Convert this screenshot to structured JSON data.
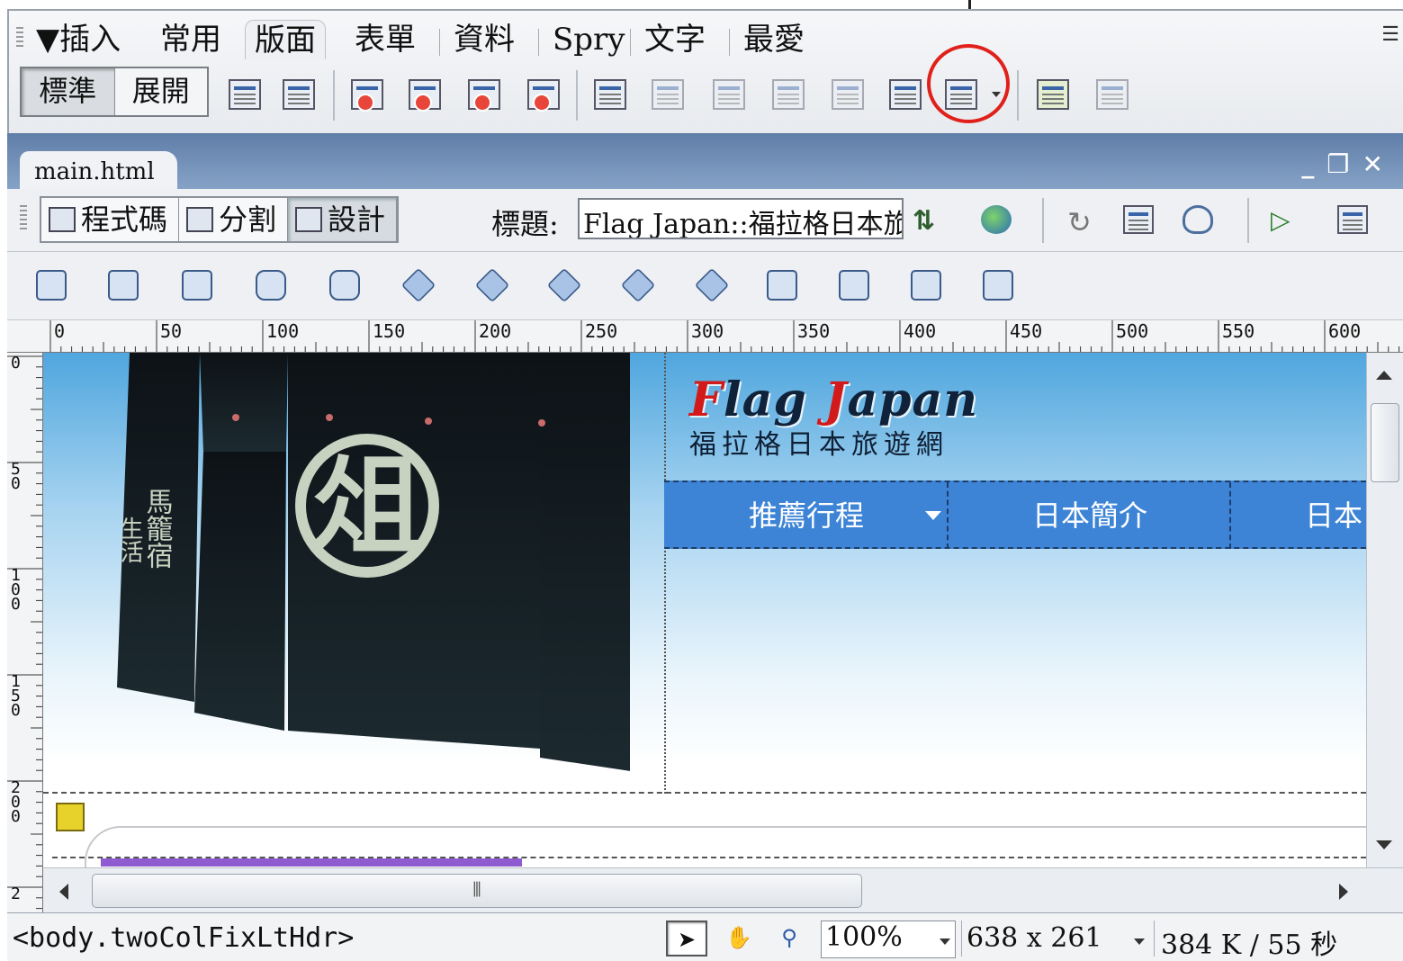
{
  "insert_panel": {
    "title": "▼插入",
    "tabs": [
      "常用",
      "版面",
      "表單",
      "資料",
      "Spry",
      "文字",
      "最愛"
    ],
    "active_tab": "版面",
    "mode_buttons": [
      "標準",
      "展開"
    ],
    "pressed_mode": "標準",
    "highlight_color": "#e0211b"
  },
  "document": {
    "tab_label": "main.html",
    "view_buttons": [
      "程式碼",
      "分割",
      "設計"
    ],
    "active_view": "設計",
    "title_label": "標題:",
    "title_value": "Flag Japan::福拉格日本旅遊網"
  },
  "ruler": {
    "top_ticks": [
      "0",
      "50",
      "100",
      "150",
      "200",
      "250",
      "300",
      "350",
      "400",
      "450",
      "500",
      "550",
      "600"
    ],
    "left_ticks": [
      "0",
      "50",
      "100",
      "150",
      "200",
      "2"
    ]
  },
  "page": {
    "logo_main_part1": "F",
    "logo_main_part2": "lag ",
    "logo_main_part3": "J",
    "logo_main_part4": "apan",
    "logo_sub": "福拉格日本旅遊網",
    "nav": [
      "推薦行程",
      "日本簡介",
      "日本"
    ],
    "noren_kanji": "俎",
    "noren_side_text_1": "馬籠宿",
    "noren_side_text_2": "生活",
    "nav_color": "#3d84d6"
  },
  "status": {
    "tag_path": "<body.twoColFixLtHdr>",
    "zoom": "100%",
    "window_size": "638 x 261",
    "download_stats": "384 K / 55 秒"
  }
}
